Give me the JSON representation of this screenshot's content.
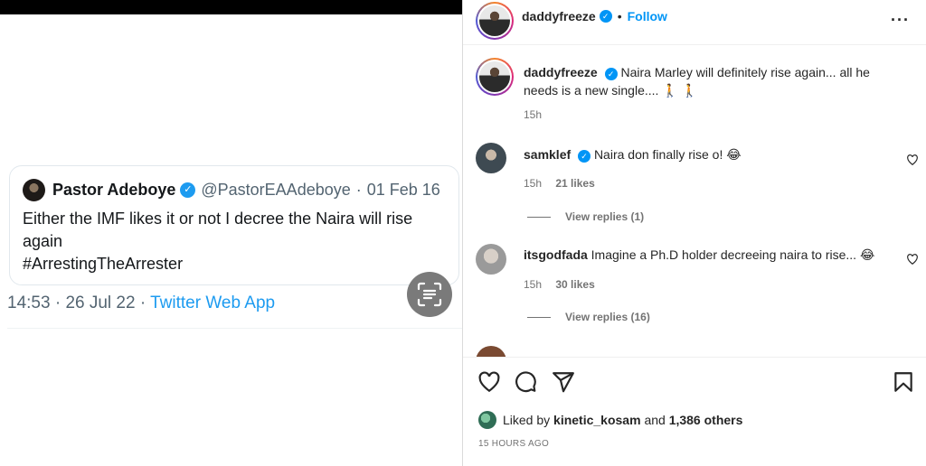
{
  "tweet": {
    "author_name": "Pastor Adeboye",
    "handle": "@PastorEAAdeboye",
    "separator": "·",
    "date": "01 Feb 16",
    "text_lines": [
      "Either the IMF likes it or not I decree the Naira will rise",
      "again",
      "#ArrestingTheArrester"
    ],
    "time": "14:53",
    "full_date": "26 Jul 22",
    "app": "Twitter Web App",
    "verified_icon": "blue-check-badge"
  },
  "post": {
    "username": "daddyfreeze",
    "dot": "•",
    "follow_label": "Follow",
    "more_icon": "···",
    "caption_user": "daddyfreeze",
    "caption_text": "Naira Marley will definitely rise again... all he needs is a new single.... 🚶 🚶",
    "caption_time": "15h"
  },
  "comments": [
    {
      "user": "samklef",
      "verified": true,
      "text": "Naira don finally rise o! 😂",
      "time": "15h",
      "likes": "21 likes",
      "replies": "View replies (1)"
    },
    {
      "user": "itsgodfada",
      "verified": false,
      "text": "Imagine a Ph.D holder decreeing naira to rise... 😂",
      "time": "15h",
      "likes": "30 likes",
      "replies": "View replies (16)"
    }
  ],
  "footer": {
    "liked_prefix": "Liked by",
    "liked_user": "kinetic_kosam",
    "liked_and": "and",
    "liked_others": "1,386 others",
    "time_ago": "15 HOURS AGO"
  },
  "colors": {
    "ig_blue": "#0095f6",
    "twitter_blue": "#1d9bf0",
    "muted": "#737373"
  }
}
